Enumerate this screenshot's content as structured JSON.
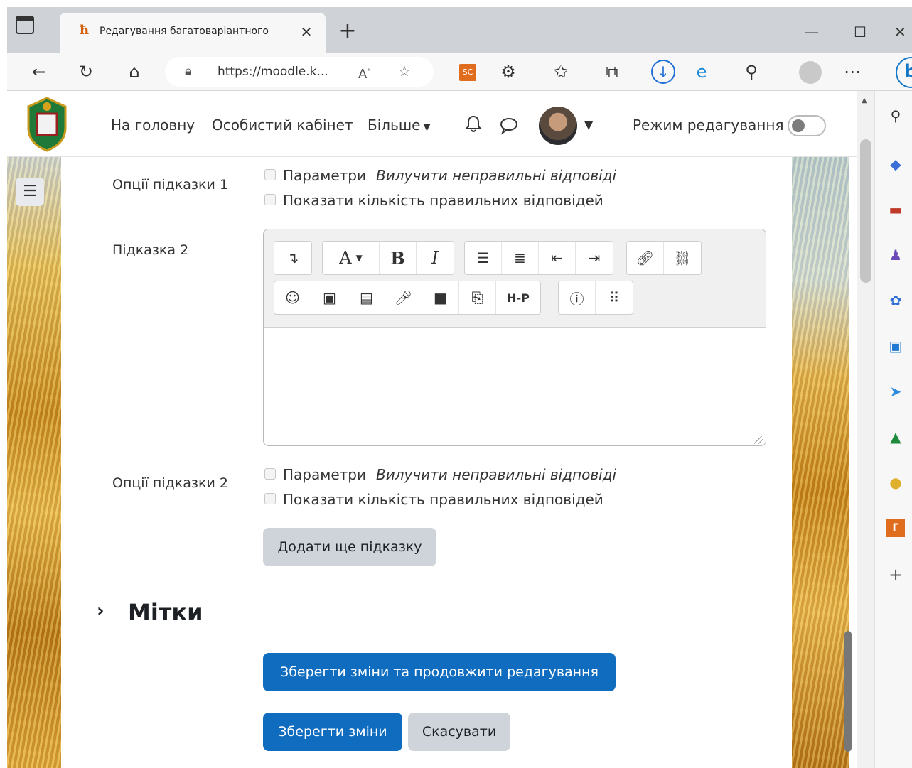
{
  "browser": {
    "tab_title": "Редагування багатоваріантного",
    "tab_favicon": "ħ",
    "url": "https://moodle.k...",
    "ext_sc": "SC",
    "bing": "b"
  },
  "navbar": {
    "home": "На головну",
    "dashboard": "Особистий кабінет",
    "more": "Більше",
    "edit_mode": "Режим редагування"
  },
  "form": {
    "hint1_options_label": "Опції підказки 1",
    "hint2_label": "Підказка 2",
    "hint2_options_label": "Опції підказки 2",
    "opt_params": "Параметри",
    "opt_remove_wrong": "Вилучити неправильні відповіді",
    "opt_show_count": "Показати кількість правильних відповідей",
    "add_hint": "Додати ще підказку",
    "tags_section": "Мітки",
    "save_continue": "Зберегти зміни та продовжити редагування",
    "save": "Зберегти зміни",
    "cancel": "Скасувати"
  },
  "editor_toolbar": {
    "font": "A",
    "bold": "B",
    "italic": "I",
    "h5p": "H-P"
  },
  "colors": {
    "primary": "#0f6cbf",
    "secondary": "#ced4da",
    "accent_orange": "#e06d1e"
  }
}
